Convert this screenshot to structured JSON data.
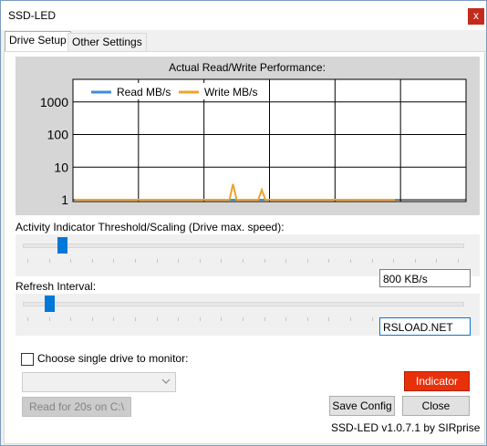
{
  "window": {
    "title": "SSD-LED",
    "close_glyph": "x"
  },
  "tabs": [
    {
      "label": "Drive Setup",
      "active": true
    },
    {
      "label": "Other Settings",
      "active": false
    }
  ],
  "chart_data": {
    "type": "line",
    "title": "Actual Read/Write Performance:",
    "yscale": "log",
    "ylim": [
      1,
      2000
    ],
    "yticks": [
      "1",
      "10",
      "100",
      "1000"
    ],
    "grid": true,
    "legend_position": "top-left",
    "x": [
      0,
      1,
      2,
      3,
      4,
      5,
      6,
      7,
      8,
      9,
      10,
      11,
      12,
      13,
      14,
      15,
      16,
      17,
      18,
      19,
      20,
      21,
      22,
      23,
      24,
      25,
      26,
      27,
      28,
      29,
      30,
      31,
      32,
      33,
      34,
      35,
      36,
      37,
      38,
      39,
      40,
      41,
      42,
      43,
      44,
      45,
      46,
      47,
      48,
      49,
      50,
      51,
      52,
      53,
      54,
      55,
      56,
      57,
      58,
      59,
      60,
      61,
      62,
      63,
      64,
      65,
      66,
      67,
      68,
      69,
      70,
      71,
      72,
      73,
      74,
      75,
      76,
      77,
      78,
      79,
      80,
      81,
      82,
      83,
      84,
      85,
      86,
      87,
      88,
      89
    ],
    "series": [
      {
        "name": "Read MB/s",
        "color": "#3c8fd8",
        "values": [
          1,
          1,
          1,
          1,
          1,
          1,
          1,
          1,
          1,
          1,
          1,
          1,
          1,
          1,
          1,
          1,
          1,
          1,
          1,
          1,
          1,
          1,
          1,
          1,
          1,
          1,
          1,
          1,
          1,
          1,
          1,
          1,
          1,
          1,
          1,
          1,
          1,
          1,
          1,
          1,
          1,
          1,
          1,
          1,
          1,
          1,
          1,
          1,
          1,
          1,
          1,
          1,
          1,
          1,
          1,
          1,
          1,
          1,
          1,
          1,
          1,
          1,
          1,
          1,
          1,
          1,
          1,
          1,
          1,
          1,
          1,
          1,
          1,
          1,
          1,
          1,
          1,
          1,
          1,
          1,
          1,
          1,
          1,
          1,
          1,
          1,
          1,
          1,
          1,
          1
        ]
      },
      {
        "name": "Write MB/s",
        "color": "#f0a32b",
        "values": [
          1,
          1,
          1,
          1,
          1,
          1,
          1,
          1,
          1,
          1,
          1,
          1,
          1,
          1,
          1,
          1,
          1,
          1,
          1,
          1,
          1,
          1,
          1,
          1,
          1,
          1,
          1,
          1,
          1,
          1,
          1,
          1,
          1,
          1,
          1,
          1,
          1,
          1,
          1,
          1,
          1,
          1,
          1,
          1,
          3,
          1,
          1,
          1,
          1,
          1,
          1,
          1,
          2,
          1,
          1,
          1,
          1,
          1,
          1,
          1,
          1,
          1,
          1,
          1,
          1,
          1,
          1,
          1,
          1,
          1,
          1,
          1,
          1,
          1,
          1,
          1,
          1,
          1,
          1,
          1,
          1,
          1,
          1,
          1,
          1,
          1,
          1,
          1,
          1,
          1
        ]
      }
    ]
  },
  "threshold": {
    "label": "Activity Indicator Threshold/Scaling (Drive max. speed):",
    "value": "800 KB/s",
    "slider_fraction": 0.09
  },
  "refresh": {
    "label": "Refresh Interval:",
    "value": "RSLOAD.NET",
    "slider_fraction": 0.06
  },
  "single_drive": {
    "label": "Choose single drive to monitor:",
    "checked": false,
    "combo_value": ""
  },
  "buttons": {
    "indicator": "Indicator",
    "read_test": "Read for 20s on C:\\",
    "save_config": "Save Config",
    "close": "Close"
  },
  "version_text": "SSD-LED v1.0.7.1  by SIRprise"
}
